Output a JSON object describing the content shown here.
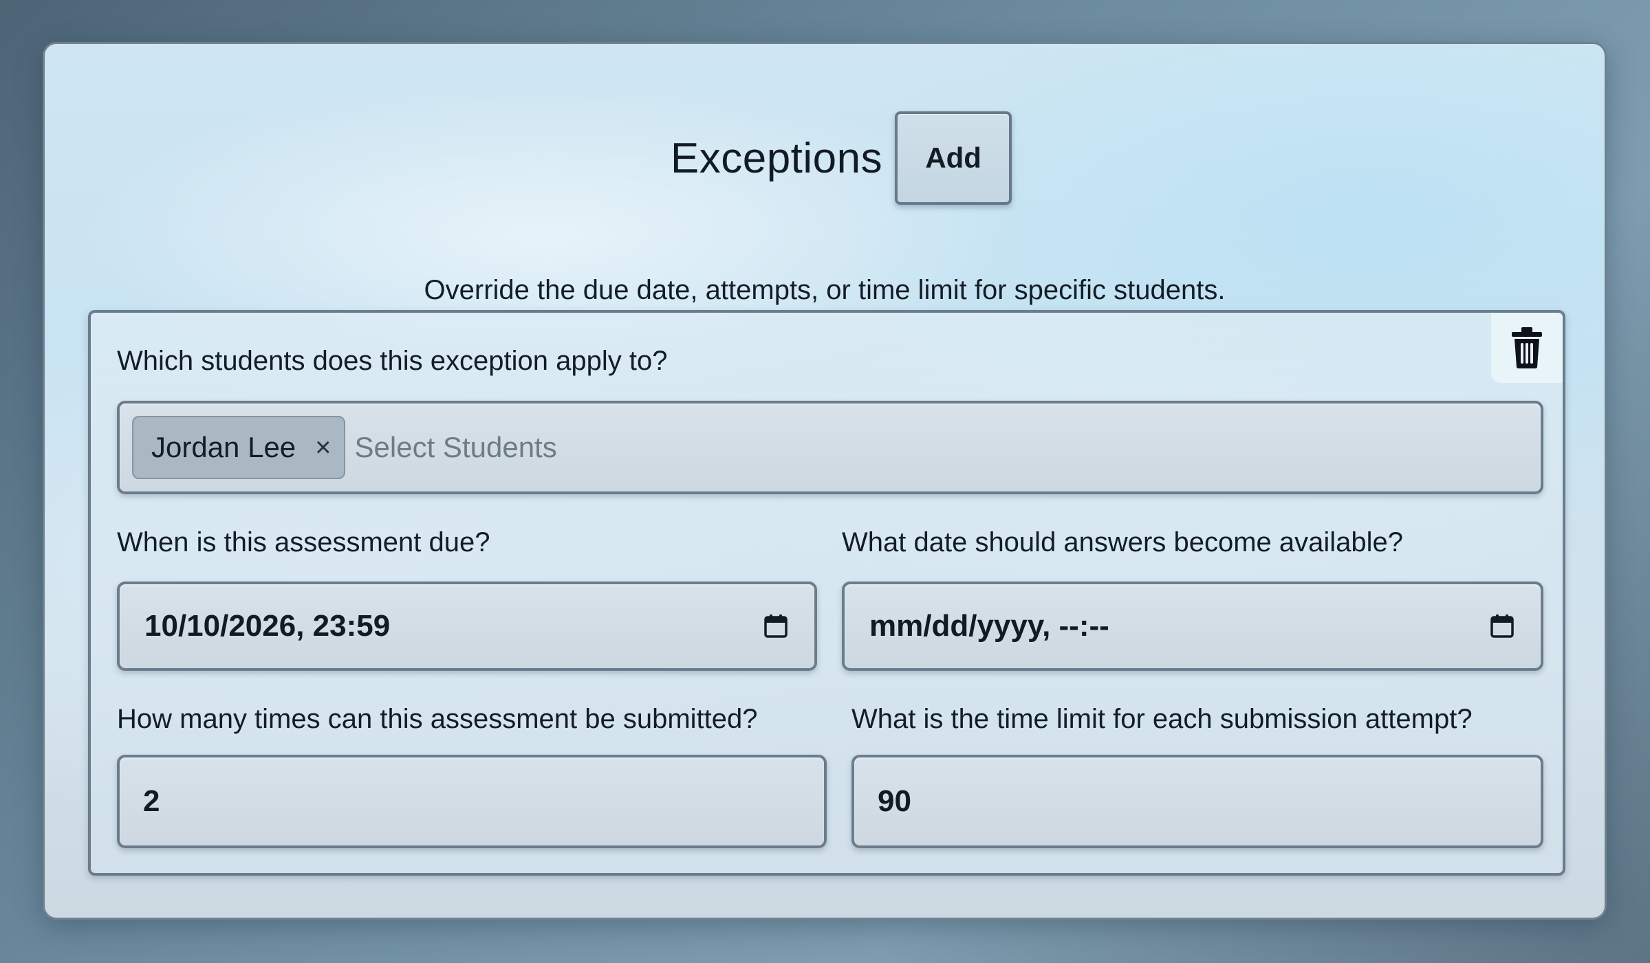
{
  "header": {
    "title": "Exceptions",
    "add_label": "Add",
    "subtitle": "Override the due date, attempts, or time limit for specific students."
  },
  "exception": {
    "students_label": "Which students does this exception apply to?",
    "selected_students": [
      "Jordan Lee"
    ],
    "remove_chip_glyph": "×",
    "students_placeholder": "Select Students",
    "due_label": "When is this assessment due?",
    "due_value": "10/10/2026, 23:59",
    "answers_label": "What date should answers become available?",
    "answers_value": "mm/dd/yyyy, --:--",
    "attempts_label": "How many times can this assessment be submitted?",
    "attempts_value": "2",
    "time_limit_label": "What is the time limit for each submission attempt?",
    "time_limit_value": "90"
  },
  "icons": {
    "delete": "trash-icon",
    "calendar": "calendar-icon",
    "remove": "close-icon"
  }
}
